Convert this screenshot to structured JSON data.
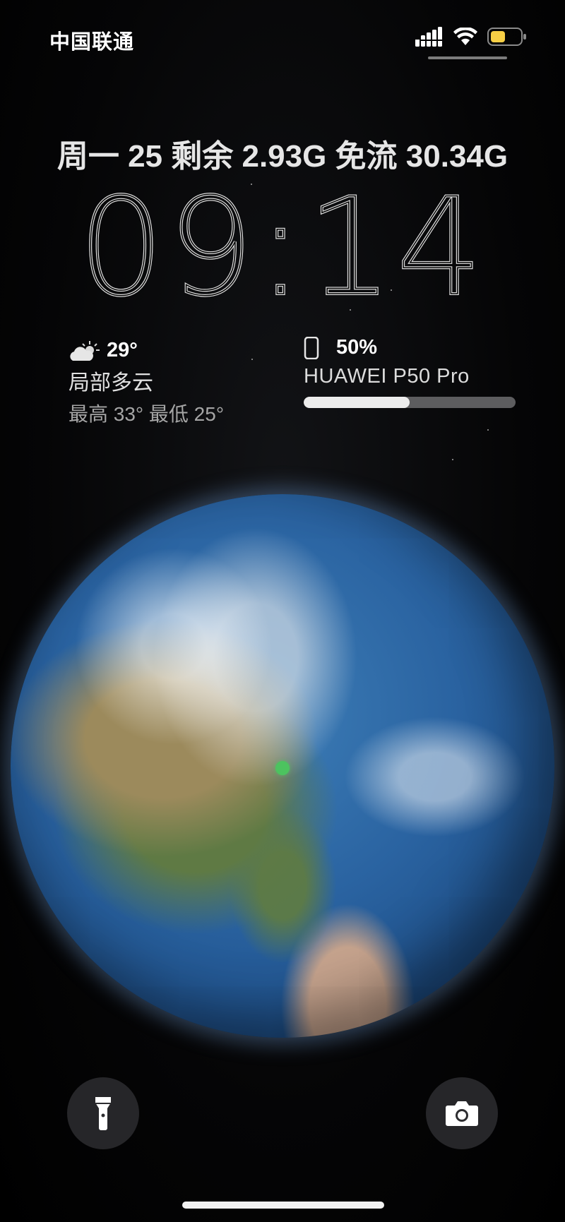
{
  "status_bar": {
    "carrier": "中国联通",
    "icons": [
      "cellular-signal-icon",
      "wifi-icon",
      "battery-icon"
    ],
    "battery_color": "#f7cf45"
  },
  "date_line": "周一 25  剩余 2.93G 免流 30.34G",
  "clock": {
    "time": "09:14"
  },
  "weather": {
    "icon": "partly-cloudy-icon",
    "temperature": "29°",
    "condition": "局部多云",
    "range": "最高 33° 最低 25°"
  },
  "device_battery": {
    "icon": "phone-icon",
    "percent_label": "50%",
    "level": 0.5,
    "device_name": "HUAWEI P50 Pro"
  },
  "quick_actions": {
    "flashlight_icon": "flashlight-icon",
    "camera_icon": "camera-icon"
  },
  "colors": {
    "location_dot": "#4cc35f",
    "battery_fill": "#ececec",
    "battery_track": "#5d5d5f"
  }
}
